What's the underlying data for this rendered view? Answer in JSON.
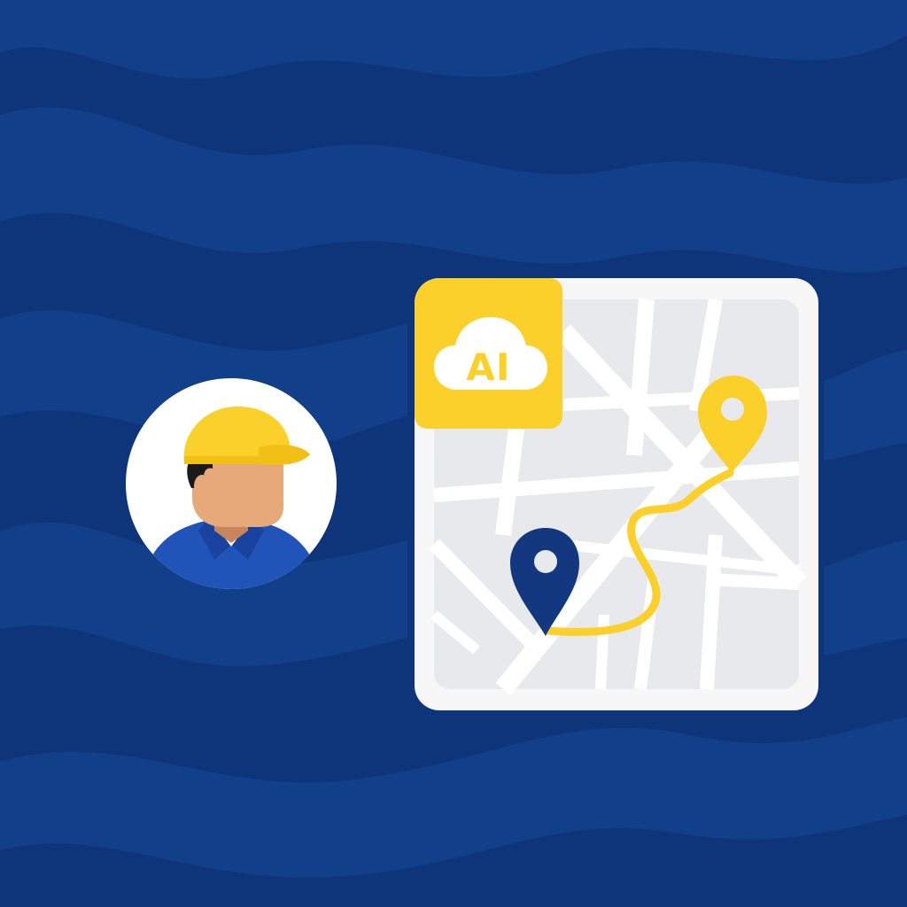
{
  "badge": {
    "label": "AI"
  },
  "colors": {
    "background": "#0e3479",
    "wave": "#123f89",
    "accent_yellow": "#fcd02a",
    "map_surface": "#e8e9ec",
    "map_roads": "#ffffff",
    "pin_blue": "#13387f",
    "shirt_blue": "#2154b8",
    "skin": "#e8a97a"
  },
  "icons": {
    "avatar": "worker-avatar-icon",
    "cloud": "cloud-icon",
    "start_pin": "location-pin-icon",
    "end_pin": "location-pin-icon",
    "route": "route-path-icon"
  }
}
